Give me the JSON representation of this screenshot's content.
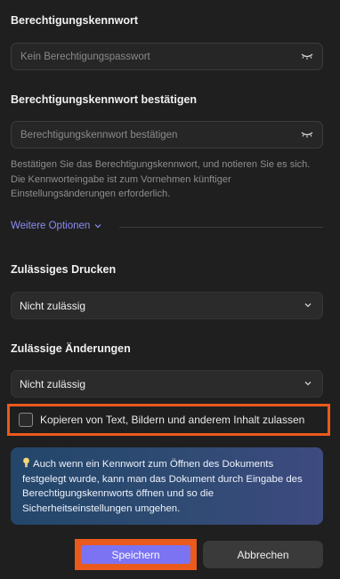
{
  "permission_password": {
    "label": "Berechtigungskennwort",
    "placeholder": "Kein Berechtigungspasswort"
  },
  "confirm_password": {
    "label": "Berechtigungskennwort bestätigen",
    "placeholder": "Berechtigungskennwort bestätigen",
    "help": "Bestätigen Sie das Berechtigungskennwort, und notieren Sie es sich. Die Kennworteingabe ist zum Vornehmen künftiger Einstellungsänderungen erforderlich."
  },
  "more_options": {
    "label": "Weitere Optionen"
  },
  "printing": {
    "label": "Zulässiges Drucken",
    "value": "Nicht zulässig"
  },
  "changes": {
    "label": "Zulässige Änderungen",
    "value": "Nicht zulässig"
  },
  "copy_content": {
    "label": "Kopieren von Text, Bildern und anderem Inhalt zulassen",
    "checked": false
  },
  "info": {
    "text": "Auch wenn ein Kennwort zum Öffnen des Dokuments festgelegt wurde, kann man das Dokument durch Eingabe des Berechtigungskennworts öffnen und so die Sicherheitseinstellungen umgehen."
  },
  "buttons": {
    "save": "Speichern",
    "cancel": "Abbrechen"
  },
  "colors": {
    "background": "#1f1f1f",
    "accent": "#7b73f2",
    "link": "#8b8df4",
    "highlight": "#ea5a1c",
    "info_bg": "#2f4b73"
  }
}
